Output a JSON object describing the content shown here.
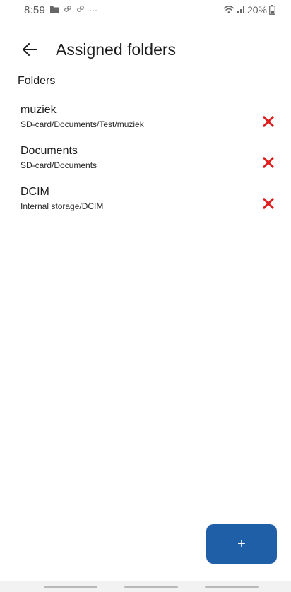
{
  "status_bar": {
    "time": "8:59",
    "more_indicator": "⋯",
    "battery": "20%",
    "icons": [
      "folder-icon",
      "link-icon",
      "link-icon",
      "wifi-icon",
      "signal-icon",
      "battery-icon"
    ]
  },
  "app_bar": {
    "title": "Assigned folders",
    "back_icon": "arrow-left-icon"
  },
  "section": {
    "header": "Folders"
  },
  "folders": [
    {
      "name": "muziek",
      "path": "SD-card/Documents/Test/muziek"
    },
    {
      "name": "Documents",
      "path": "SD-card/Documents"
    },
    {
      "name": "DCIM",
      "path": "Internal storage/DCIM"
    }
  ],
  "fab": {
    "label": "+"
  },
  "colors": {
    "accent": "#1f5fa8",
    "remove": "#e01b1b",
    "text": "#1c1c1c"
  }
}
